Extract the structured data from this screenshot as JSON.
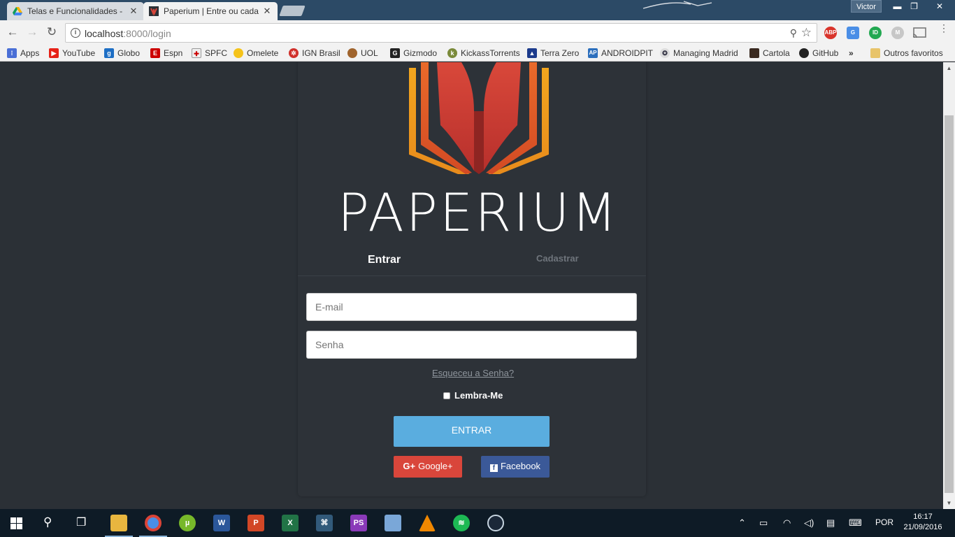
{
  "browser": {
    "tabs": [
      {
        "title": "Telas e Funcionalidades - ",
        "close": "✕",
        "icon": "google-drive-icon"
      },
      {
        "title": "Paperium | Entre ou cada",
        "close": "✕",
        "icon": "paperium-icon"
      }
    ],
    "user": "Victor",
    "url_host": "localhost",
    "url_path": ":8000/login",
    "extensions": [
      "ABP",
      "G",
      "ID",
      "M"
    ],
    "bookmarks": [
      "Apps",
      "YouTube",
      "Globo",
      "Espn",
      "SPFC",
      "Omelete",
      "IGN Brasil",
      "UOL",
      "Gizmodo",
      "KickassTorrents",
      "Terra Zero",
      "ANDROIDPIT",
      "Managing Madrid",
      "Cartola",
      "GitHub"
    ],
    "more": "»",
    "other_bookmarks": "Outros favoritos"
  },
  "page": {
    "brand": "PAPERIUM",
    "tab_login": "Entrar",
    "tab_register": "Cadastrar",
    "email_placeholder": "E-mail",
    "password_placeholder": "Senha",
    "forgot": "Esqueceu a Senha?",
    "remember": "Lembra-Me",
    "enter_button": "ENTRAR",
    "google_button": "Google+",
    "facebook_button": "Facebook",
    "colors": {
      "enter": "#5aaddf",
      "google": "#d9463b",
      "facebook": "#3b5998",
      "background": "#2b3036"
    }
  },
  "taskbar": {
    "apps": [
      "File Explorer",
      "Chrome",
      "uTorrent",
      "Word",
      "PowerPoint",
      "Excel",
      "MySQL Workbench",
      "PhpStorm",
      "VirtualBox",
      "VLC",
      "Spotify",
      "Steam"
    ],
    "language": "POR",
    "time": "16:17",
    "date": "21/09/2016"
  }
}
